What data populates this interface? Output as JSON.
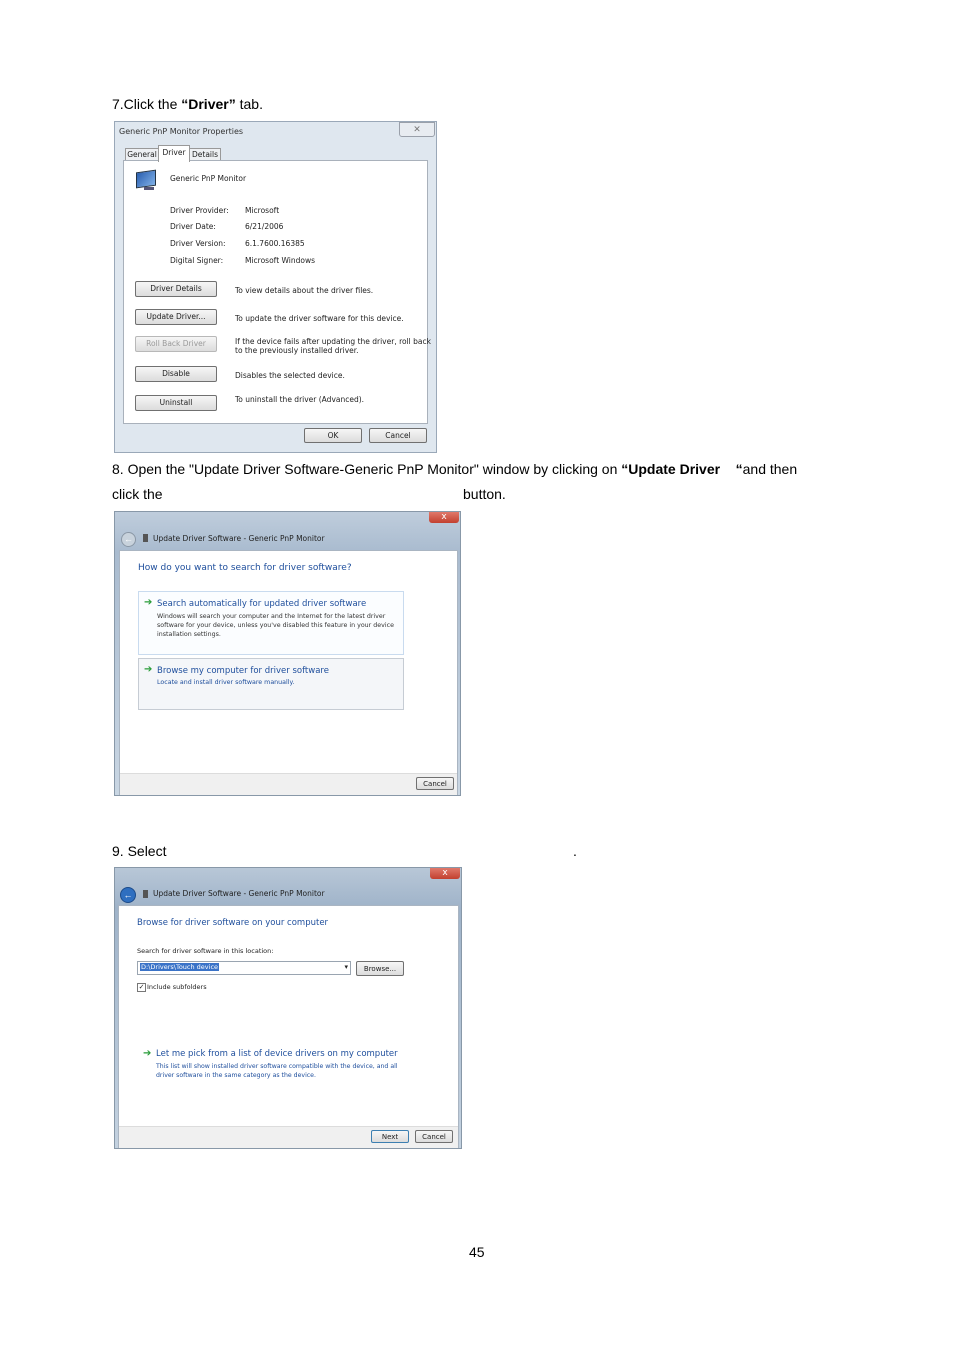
{
  "step7": {
    "prefix": "7.Click the ",
    "bold": "“Driver”",
    "suffix": " tab."
  },
  "dialog1": {
    "title": "Generic PnP Monitor Properties",
    "tabs": [
      "General",
      "Driver",
      "Details"
    ],
    "device_name": "Generic PnP Monitor",
    "info": [
      {
        "label": "Driver Provider:",
        "value": "Microsoft"
      },
      {
        "label": "Driver Date:",
        "value": "6/21/2006"
      },
      {
        "label": "Driver Version:",
        "value": "6.1.7600.16385"
      },
      {
        "label": "Digital Signer:",
        "value": "Microsoft Windows"
      }
    ],
    "actions": [
      {
        "button": "Driver Details",
        "desc": "To view details about the driver files."
      },
      {
        "button": "Update Driver...",
        "desc": "To update the driver software for this device."
      },
      {
        "button": "Roll Back Driver",
        "desc": "If the device fails after updating the driver, roll back",
        "desc2": "to the previously installed driver."
      },
      {
        "button": "Disable",
        "desc": "Disables the selected device."
      },
      {
        "button": "Uninstall",
        "desc": "To uninstall the driver (Advanced)."
      }
    ],
    "ok": "OK",
    "cancel": "Cancel"
  },
  "step8": {
    "line1_prefix": "8. Open the \"Update Driver Software-Generic PnP Monitor\" window by clicking on ",
    "line1_bold": "“Update Driver    “",
    "line1_suffix": "and then",
    "line2_left": "click the",
    "line2_right": "button."
  },
  "dialog2": {
    "title": "Update Driver Software - Generic PnP Monitor",
    "question": "How do you want to search for driver software?",
    "opt1_title": "Search automatically for updated driver software",
    "opt1_desc": [
      "Windows will search your computer and the Internet for the latest driver",
      "software for your device, unless you've disabled this feature in your device",
      "installation settings."
    ],
    "opt2_title": "Browse my computer for driver software",
    "opt2_desc": "Locate and install driver software manually.",
    "cancel": "Cancel",
    "close": "x"
  },
  "step9": {
    "prefix": "9. Select",
    "suffix": "."
  },
  "dialog3": {
    "title": "Update Driver Software - Generic PnP Monitor",
    "heading": "Browse for driver software on your computer",
    "search_label": "Search for driver software in this location:",
    "path_value": "D:\\Drivers\\Touch device",
    "browse": "Browse...",
    "include_subfolders": "Include subfolders",
    "pick_title": "Let me pick from a list of device drivers on my computer",
    "pick_desc": [
      "This list will show installed driver software compatible with the device, and all",
      "driver software in the same category as the device."
    ],
    "next": "Next",
    "cancel": "Cancel",
    "close": "x"
  },
  "page_number": "45",
  "colors": {
    "link_blue": "#1e4e9c",
    "arrow_green": "#2a9d3a",
    "close_red": "#c2402f"
  }
}
